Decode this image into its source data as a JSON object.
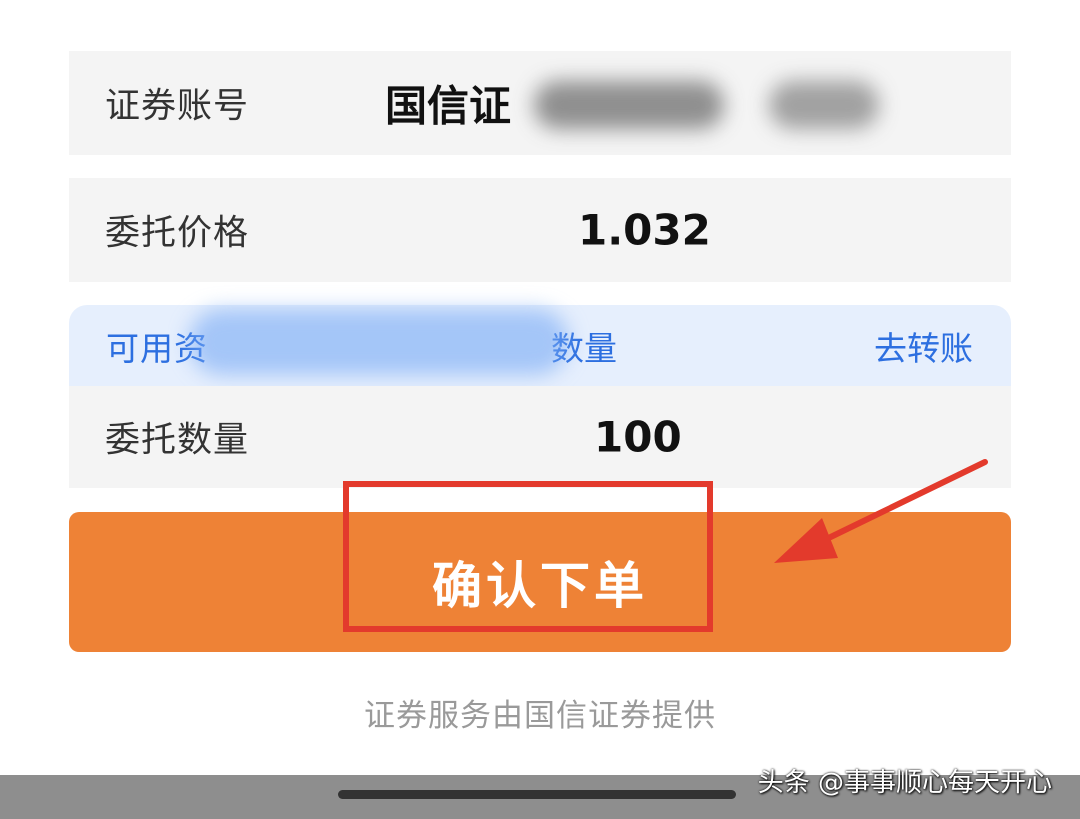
{
  "order_form": {
    "account": {
      "label": "证券账号",
      "value": "国信证"
    },
    "price": {
      "label": "委托价格",
      "value": "1.032"
    },
    "available": {
      "label_prefix": "可用资",
      "label_suffix": "数量",
      "link": "去转账"
    },
    "quantity": {
      "label": "委托数量",
      "value": "100"
    }
  },
  "confirm_button": {
    "label": "确认下单",
    "color": "#ee8236"
  },
  "annotation": {
    "color": "#e33a2c"
  },
  "footer": {
    "note": "证券服务由国信证券提供"
  },
  "watermark": {
    "text": "头条 @事事顺心每天开心"
  }
}
